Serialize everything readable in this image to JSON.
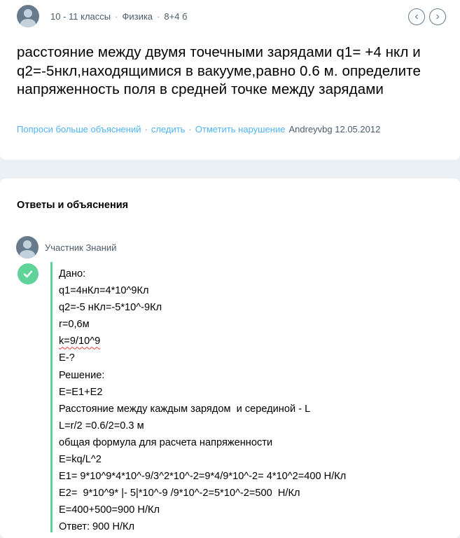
{
  "question": {
    "meta": {
      "grade": "10 - 11 классы",
      "subject": "Физика",
      "points": "8+4 б"
    },
    "nav": {
      "prev_icon": "‹",
      "next_icon": "›"
    },
    "text": "расстояние между двумя точечными зарядами q1= +4 нкл и q2=-5нкл,находящимися в вакууме,равно 0.6 м. определите напряженность поля в средней точке между зарядами",
    "actions": {
      "ask_more": "Попроси больше объяснений",
      "follow": "следить",
      "report": "Отметить нарушение",
      "author": "Andreyvbg 12.05.2012"
    }
  },
  "answers": {
    "title": "Ответы и объяснения",
    "author": "Участник Знаний",
    "lines": [
      "Дано:",
      "q1=4нКл=4*10^9Кл",
      "q2=-5 нКл=-5*10^-9Кл",
      "r=0,6м",
      "k=9/10^9",
      "E-?",
      "Решение:",
      "E=E1+E2",
      "Расстояние между каждым зарядом  и серединой - L",
      "L=r/2 =0.6/2=0.3 м",
      "общая формула для расчета напряженности",
      "E=kq/L^2",
      "E1= 9*10^9*4*10^-9/3^2*10^-2=9*4/9*10^-2= 4*10^2=400 Н/Кл",
      "E2=  9*10^9* |- 5|*10^-9 /9*10^-2=5*10^-2=500  Н/Кл",
      "E=400+500=900 Н/Кл",
      "Ответ: 900 Н/Кл"
    ]
  },
  "colors": {
    "accent_blue": "#4fb3f6",
    "accent_green": "#60d399",
    "page_bg": "#ebf0f4"
  }
}
